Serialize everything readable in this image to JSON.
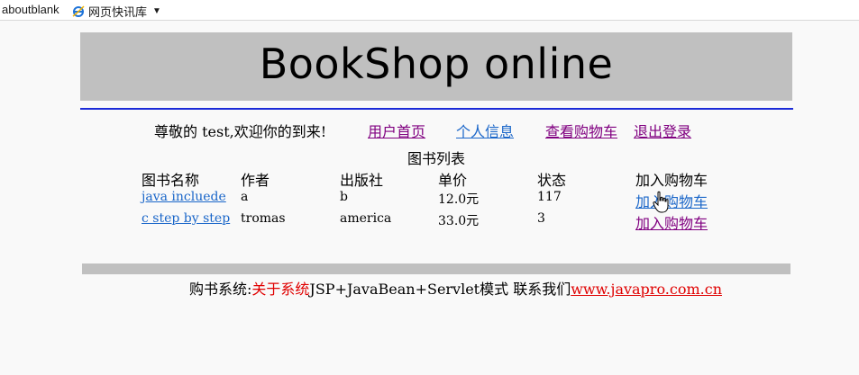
{
  "favbar": {
    "aboutblank": "aboutblank",
    "webslice_label": "网页快讯库",
    "icons": {
      "web_slice": "ie-icon",
      "dropdown": "chevron-down-icon"
    }
  },
  "banner": {
    "title": "BookShop online"
  },
  "nav": {
    "welcome": "尊敬的 test,欢迎你的到来!",
    "home": "用户首页",
    "profile": "个人信息",
    "cart": "查看购物车",
    "logout": "退出登录"
  },
  "table": {
    "caption": "图书列表",
    "headers": [
      "图书名称",
      "作者",
      "出版社",
      "单价",
      "状态",
      "加入购物车"
    ],
    "rows": [
      {
        "name": "java incluede",
        "author": "a",
        "publisher": "b",
        "price": "12.0元",
        "status": "117",
        "action": "加入购物车"
      },
      {
        "name": "c step by step",
        "author": "tromas",
        "publisher": "america",
        "price": "33.0元",
        "status": "3",
        "action": "加入购物车"
      }
    ]
  },
  "footer": {
    "prefix": "购书系统:",
    "about": "关于系统",
    "middle": "JSP+JavaBean+Servlet模式 联系我们",
    "url": "www.javapro.com.cn"
  },
  "colors": {
    "banner_bg": "#c0c0c0",
    "divider": "#1c2bd8",
    "link_blue": "#1a66c9",
    "link_visited": "#800080",
    "footer_red": "#e00000"
  }
}
